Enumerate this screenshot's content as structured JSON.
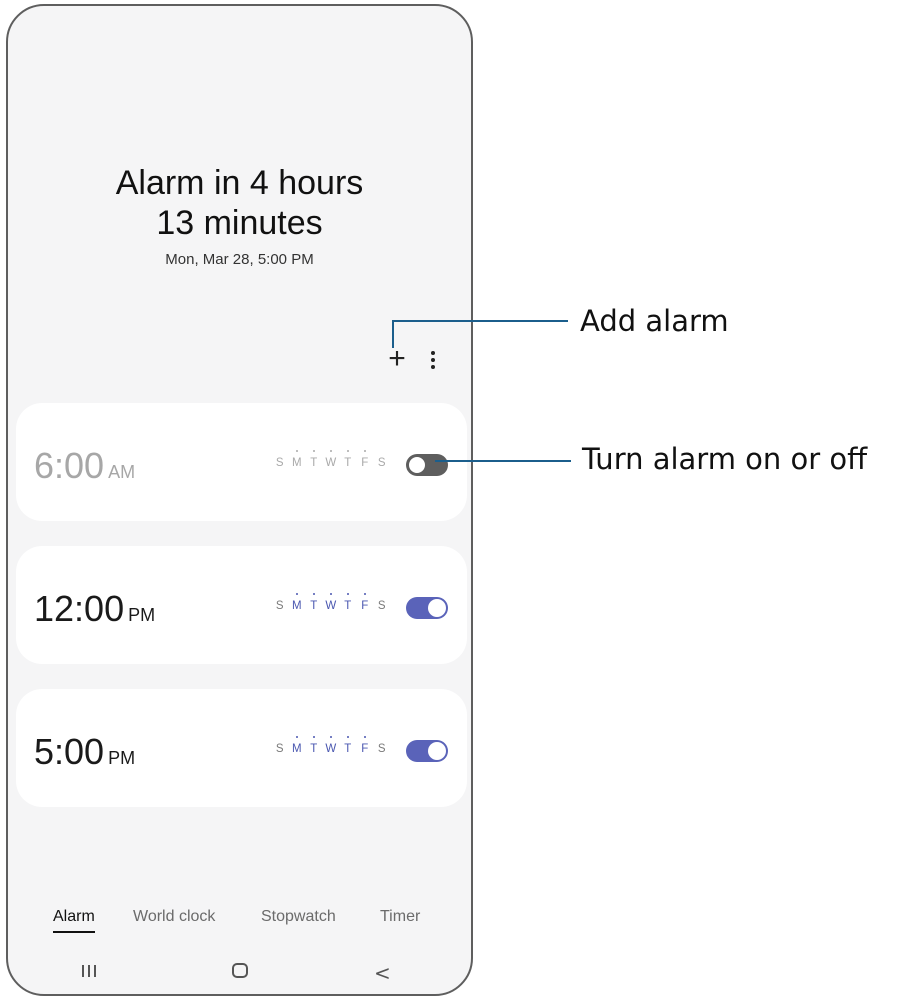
{
  "header": {
    "line1": "Alarm in 4 hours",
    "line2": "13 minutes",
    "subtitle": "Mon, Mar 28, 5:00 PM"
  },
  "toolbar": {
    "add_label": "+",
    "add_icon": "plus-icon",
    "more_icon": "more-vertical-icon"
  },
  "alarms": [
    {
      "time": "6:00",
      "ampm": "AM",
      "enabled": false,
      "days": [
        "S",
        "M",
        "T",
        "W",
        "T",
        "F",
        "S"
      ],
      "active_days": [
        false,
        true,
        true,
        true,
        true,
        true,
        false
      ]
    },
    {
      "time": "12:00",
      "ampm": "PM",
      "enabled": true,
      "days": [
        "S",
        "M",
        "T",
        "W",
        "T",
        "F",
        "S"
      ],
      "active_days": [
        false,
        true,
        true,
        true,
        true,
        true,
        false
      ]
    },
    {
      "time": "5:00",
      "ampm": "PM",
      "enabled": true,
      "days": [
        "S",
        "M",
        "T",
        "W",
        "T",
        "F",
        "S"
      ],
      "active_days": [
        false,
        true,
        true,
        true,
        true,
        true,
        false
      ]
    }
  ],
  "tabs": [
    {
      "label": "Alarm",
      "active": true
    },
    {
      "label": "World clock",
      "active": false
    },
    {
      "label": "Stopwatch",
      "active": false
    },
    {
      "label": "Timer",
      "active": false
    }
  ],
  "navbar": {
    "recents_icon": "recents-icon",
    "home_icon": "home-icon",
    "back_icon": "back-chevron-icon",
    "back_glyph": "<"
  },
  "callouts": {
    "add_alarm": "Add alarm",
    "toggle": "Turn alarm on or off"
  },
  "colors": {
    "accent": "#5a63b9",
    "toggle_off": "#5e5e5e",
    "callout_line": "#1b5e8c",
    "background": "#f5f5f6"
  }
}
